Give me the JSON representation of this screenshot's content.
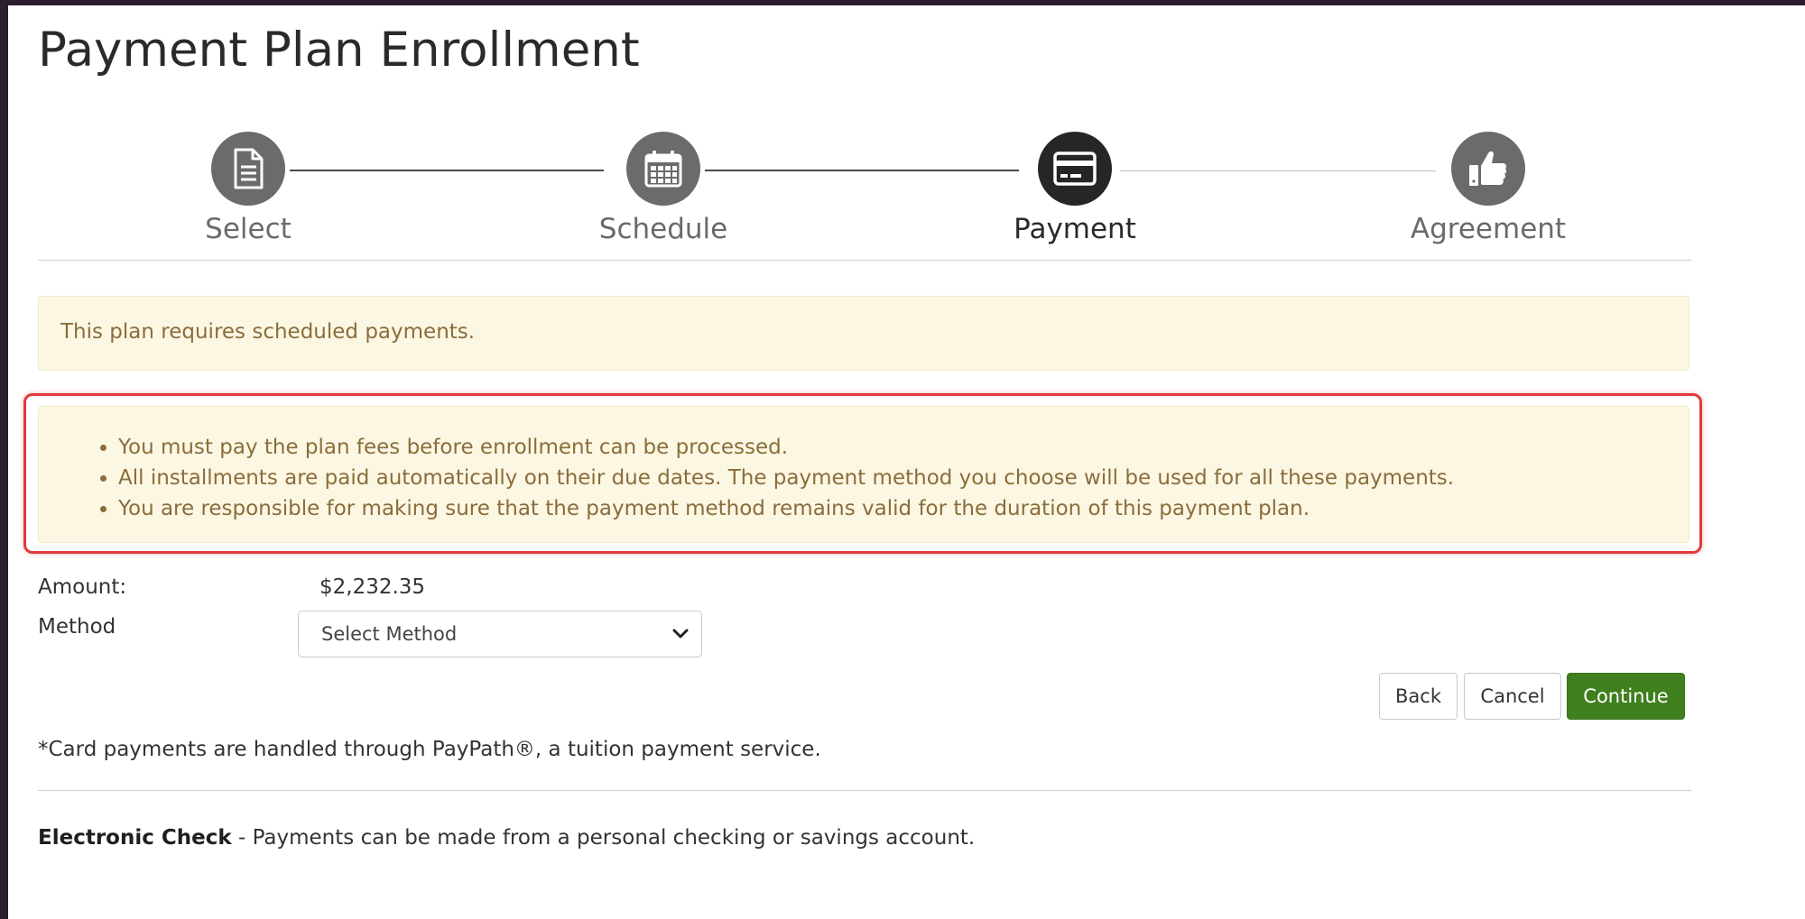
{
  "page": {
    "title": "Payment Plan Enrollment"
  },
  "steps": [
    {
      "label": "Select",
      "icon": "document-icon",
      "state": "complete"
    },
    {
      "label": "Schedule",
      "icon": "calendar-icon",
      "state": "complete"
    },
    {
      "label": "Payment",
      "icon": "credit-card-icon",
      "state": "active"
    },
    {
      "label": "Agreement",
      "icon": "thumbs-up-icon",
      "state": "upcoming"
    }
  ],
  "alerts": {
    "scheduled_notice": "This plan requires scheduled payments.",
    "rules": [
      "You must pay the plan fees before enrollment can be processed.",
      "All installments are paid automatically on their due dates. The payment method you choose will be used for all these payments.",
      "You are responsible for making sure that the payment method remains valid for the duration of this payment plan."
    ]
  },
  "form": {
    "amount_label": "Amount:",
    "amount_value": "$2,232.35",
    "method_label": "Method",
    "method_selected": "Select Method"
  },
  "buttons": {
    "back": "Back",
    "cancel": "Cancel",
    "continue": "Continue"
  },
  "footer": {
    "card_note": "*Card payments are handled through PayPath®, a tuition payment service.",
    "echeck_title": "Electronic Check",
    "echeck_desc": " - Payments can be made from a personal checking or savings account."
  },
  "colors": {
    "primary_button": "#3f7f1e",
    "alert_background": "#fcf7e3",
    "alert_text": "#8a6d3b",
    "highlight_border": "#e03a3a",
    "active_step": "#262626",
    "inactive_step": "#6b6b6b"
  }
}
